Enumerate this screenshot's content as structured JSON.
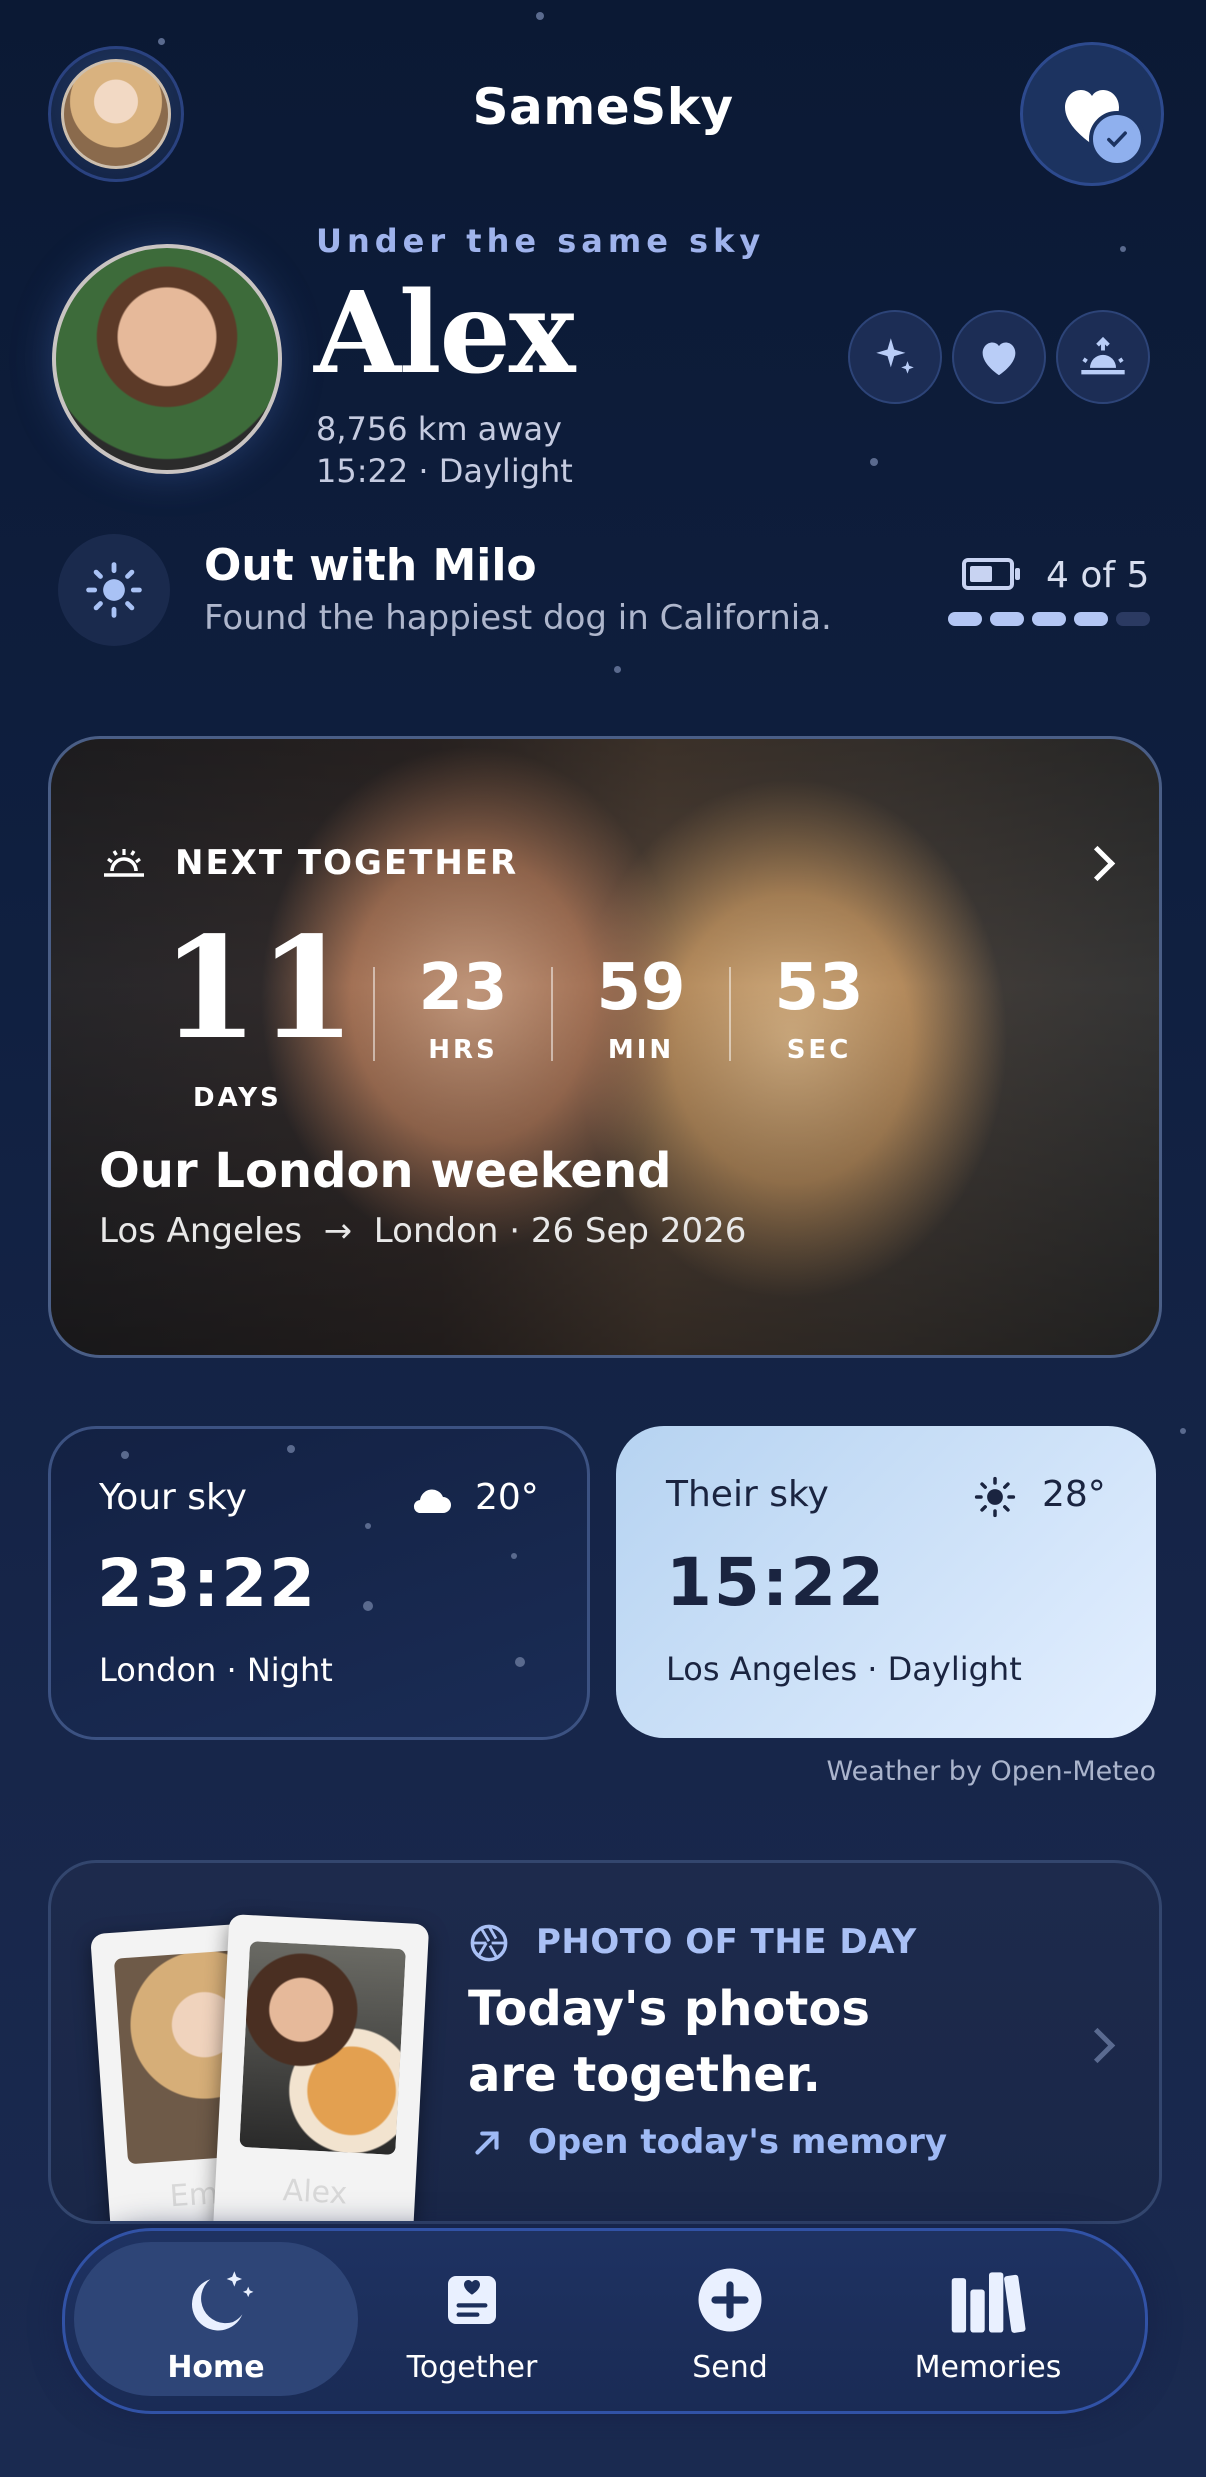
{
  "app": {
    "title": "SameSky"
  },
  "profile": {
    "subtitle": "Under the same sky",
    "name": "Alex",
    "distance": "8,756 km away",
    "local_time": "15:22 · Daylight"
  },
  "status": {
    "title": "Out with Milo",
    "text": "Found the happiest dog in California.",
    "count": "4 of 5",
    "battery_level_fraction": 0.8,
    "dots_filled": 4,
    "dots_total": 5
  },
  "next_together": {
    "label": "NEXT TOGETHER",
    "days": "11",
    "days_label": "DAYS",
    "hours": "23",
    "hours_label": "HRS",
    "minutes": "59",
    "minutes_label": "MIN",
    "seconds": "53",
    "seconds_label": "SEC",
    "title": "Our London weekend",
    "from": "Los Angeles",
    "to": "London",
    "date": "· 26 Sep 2026"
  },
  "your_sky": {
    "label": "Your sky",
    "temp": "20°",
    "time": "23:22",
    "location": "London · Night",
    "icon": "cloud-icon"
  },
  "their_sky": {
    "label": "Their sky",
    "temp": "28°",
    "time": "15:22",
    "location": "Los Angeles · Daylight",
    "icon": "sun-icon"
  },
  "weather_credit": "Weather by Open-Meteo",
  "photo_of_day": {
    "label": "PHOTO OF THE DAY",
    "title_line1": "Today's photos",
    "title_line2": "are together.",
    "link": "Open today's memory",
    "polaroid_left": "Emm",
    "polaroid_right": "Alex"
  },
  "nav": {
    "items": [
      {
        "label": "Home",
        "icon": "moon-stars-icon",
        "active": true
      },
      {
        "label": "Together",
        "icon": "note-icon",
        "active": false
      },
      {
        "label": "Send",
        "icon": "plus-circle-icon",
        "active": false
      },
      {
        "label": "Memories",
        "icon": "books-icon",
        "active": false
      }
    ]
  },
  "colors": {
    "accent": "#9fbaf5",
    "background": "#0f1f3f",
    "day_card": "#cfe2fa"
  }
}
